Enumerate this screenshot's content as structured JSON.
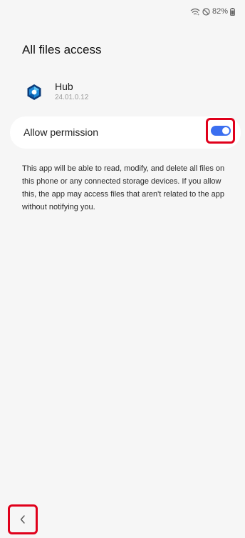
{
  "status_bar": {
    "battery_text": "82%",
    "icons": [
      "wifi-signal-icon",
      "do-not-disturb-icon",
      "battery-icon"
    ]
  },
  "page": {
    "title": "All files access"
  },
  "app": {
    "name": "Hub",
    "version": "24.01.0.12",
    "icon": "hub-app-icon"
  },
  "permission": {
    "label": "Allow permission",
    "enabled": true,
    "toggle_color": "#3b6ff0"
  },
  "description": "This app will be able to read, modify, and delete all files on this phone or any connected storage devices. If you allow this, the app may access files that aren't related to the app without notifying you.",
  "navigation": {
    "back_icon": "chevron-left-icon"
  },
  "colors": {
    "background": "#f6f6f6",
    "card": "#ffffff",
    "accent": "#3b6ff0",
    "highlight": "#e0001b"
  }
}
